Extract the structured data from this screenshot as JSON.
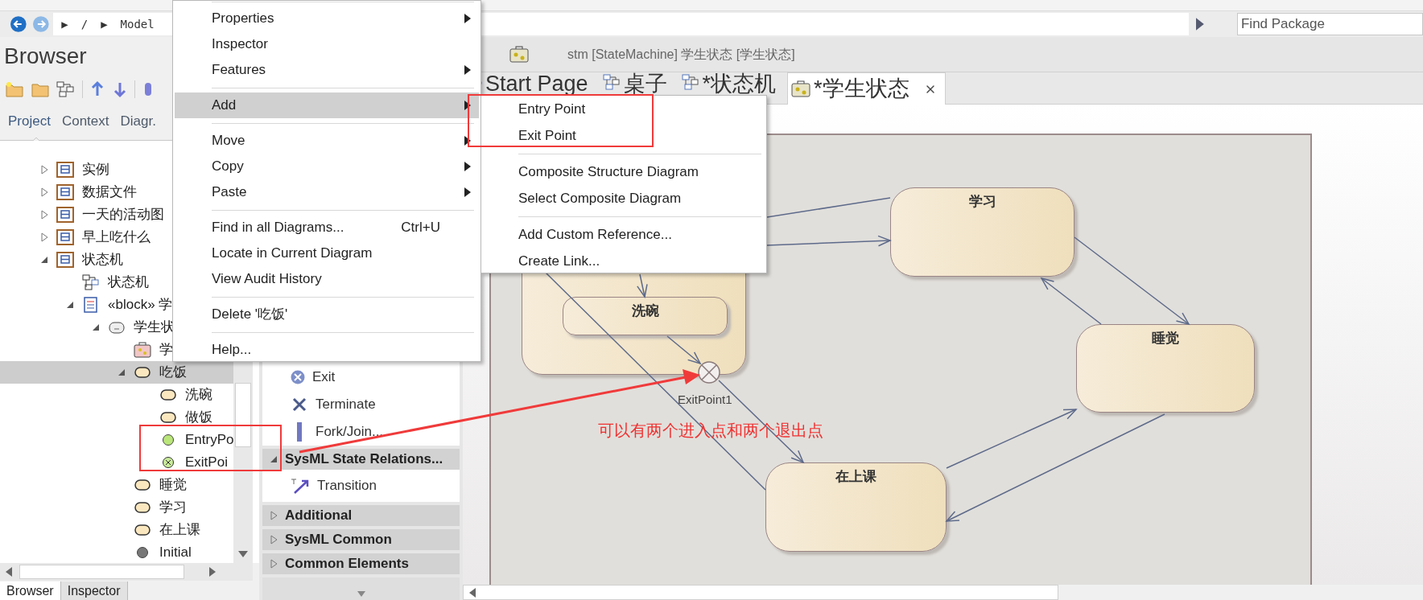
{
  "breadcrumb": {
    "parts": [
      "▶",
      "/",
      "▶",
      "Model"
    ]
  },
  "find_package": {
    "placeholder": "Find Package"
  },
  "browser": {
    "title": "Browser",
    "tabs": [
      {
        "label": "Project",
        "selected": true
      },
      {
        "label": "Context",
        "selected": false
      },
      {
        "label": "Diagr.",
        "selected": false
      }
    ],
    "tree": [
      {
        "label": "实例",
        "kind": "package",
        "expanded": false,
        "selected": false
      },
      {
        "label": "数据文件",
        "kind": "package",
        "expanded": false,
        "selected": false
      },
      {
        "label": "一天的活动图",
        "kind": "package",
        "expanded": false,
        "selected": false
      },
      {
        "label": "早上吃什么",
        "kind": "package",
        "expanded": false,
        "selected": false
      },
      {
        "label": "状态机",
        "kind": "package",
        "expanded": true,
        "selected": false,
        "children": [
          {
            "label": "状态机",
            "kind": "diagram",
            "selected": false
          },
          {
            "label": "«block» 学",
            "kind": "block",
            "expanded": true,
            "selected": false,
            "children": [
              {
                "label": "学生状",
                "kind": "machine",
                "expanded": true,
                "selected": false,
                "children": [
                  {
                    "label": "学",
                    "kind": "stmdiagram",
                    "selected": false
                  },
                  {
                    "label": "吃饭",
                    "kind": "state",
                    "expanded": true,
                    "selected": true,
                    "children": [
                      {
                        "label": "洗碗",
                        "kind": "state",
                        "selected": false
                      },
                      {
                        "label": "做饭",
                        "kind": "state",
                        "selected": false
                      },
                      {
                        "label": "EntryPo",
                        "kind": "entry",
                        "selected": false
                      },
                      {
                        "label": "ExitPoi",
                        "kind": "exit",
                        "selected": false
                      }
                    ]
                  },
                  {
                    "label": "睡觉",
                    "kind": "state",
                    "selected": false
                  },
                  {
                    "label": "学习",
                    "kind": "state",
                    "selected": false
                  },
                  {
                    "label": "在上课",
                    "kind": "state",
                    "selected": false
                  },
                  {
                    "label": "Initial",
                    "kind": "initial",
                    "selected": false
                  }
                ]
              }
            ]
          }
        ]
      }
    ],
    "bottom_tabs": [
      {
        "label": "Browser",
        "selected": true
      },
      {
        "label": "Inspector",
        "selected": false
      }
    ]
  },
  "toolbox": {
    "items": [
      {
        "kind": "exit",
        "label": "Exit"
      },
      {
        "kind": "terminate",
        "label": "Terminate"
      },
      {
        "kind": "fork",
        "label": "Fork/Join..."
      },
      {
        "kind": "section",
        "label": "SysML State Relations...",
        "expanded": true
      },
      {
        "kind": "transition",
        "label": "Transition"
      },
      {
        "kind": "section",
        "label": "Additional",
        "expanded": false
      },
      {
        "kind": "section",
        "label": "SysML Common",
        "expanded": false
      },
      {
        "kind": "section",
        "label": "Common Elements",
        "expanded": false
      }
    ]
  },
  "diagram": {
    "header": "stm [StateMachine] 学生状态 [学生状态]",
    "tabs": [
      {
        "label": "Start Page",
        "kind": "start",
        "selected": false
      },
      {
        "label": "桌子",
        "kind": "diagram",
        "selected": false
      },
      {
        "label": "*状态机",
        "kind": "diagram",
        "selected": false
      },
      {
        "label": "*学生状态",
        "kind": "machine",
        "selected": true
      }
    ],
    "states": [
      {
        "kind": "composite"
      },
      {
        "kind": "state",
        "name": "洗碗"
      },
      {
        "kind": "state",
        "name": "学习"
      },
      {
        "kind": "state",
        "name": "睡觉"
      },
      {
        "kind": "state",
        "name": "在上课"
      }
    ],
    "exit_point": {
      "label": "ExitPoint1"
    },
    "note": "可以有两个进入点和两个退出点"
  },
  "context_menu": {
    "groups": [
      [
        {
          "label": "Properties",
          "submenu": true,
          "highlighted": false
        },
        {
          "label": "Inspector",
          "submenu": false,
          "highlighted": false
        },
        {
          "label": "Features",
          "submenu": true,
          "highlighted": false
        }
      ],
      [
        {
          "label": "Add",
          "submenu": true,
          "highlighted": true
        }
      ],
      [
        {
          "label": "Move",
          "submenu": true,
          "highlighted": false
        },
        {
          "label": "Copy",
          "submenu": true,
          "highlighted": false
        },
        {
          "label": "Paste",
          "submenu": true,
          "highlighted": false
        }
      ],
      [
        {
          "label": "Find in all Diagrams...",
          "shortcut": "Ctrl+U",
          "submenu": false,
          "highlighted": false
        },
        {
          "label": "Locate in Current Diagram",
          "submenu": false,
          "highlighted": false
        },
        {
          "label": "View Audit History",
          "submenu": false,
          "highlighted": false
        }
      ],
      [
        {
          "label": "Delete '吃饭'",
          "submenu": false,
          "highlighted": false
        }
      ],
      [
        {
          "label": "Help...",
          "submenu": false,
          "highlighted": false
        }
      ]
    ]
  },
  "submenu": {
    "groups": [
      [
        "Entry Point",
        "Exit Point"
      ],
      [
        "Composite Structure Diagram",
        "Select Composite Diagram"
      ],
      [
        "Add Custom Reference...",
        "Create Link..."
      ]
    ]
  }
}
